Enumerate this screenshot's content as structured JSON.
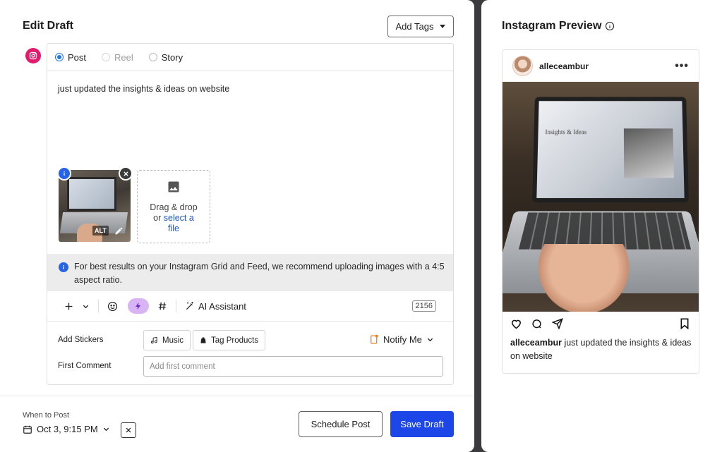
{
  "editor": {
    "title": "Edit Draft",
    "add_tags_label": "Add Tags",
    "post_types": [
      {
        "label": "Post",
        "selected": true,
        "disabled": false
      },
      {
        "label": "Reel",
        "selected": false,
        "disabled": true
      },
      {
        "label": "Story",
        "selected": false,
        "disabled": false
      }
    ],
    "caption": "just updated the insights & ideas on website",
    "media": {
      "alt_label": "ALT"
    },
    "dropzone": {
      "line1": "Drag & drop",
      "line2_prefix": "or ",
      "link_text": "select a",
      "line3": "file"
    },
    "notice": "For best results on your Instagram Grid and Feed, we recommend uploading images with a 4:5 aspect ratio.",
    "toolbar": {
      "ai_label": "AI Assistant",
      "char_count": "2156"
    },
    "stickers": {
      "label": "Add Stickers",
      "music_label": "Music",
      "tag_products_label": "Tag Products",
      "notify_label": "Notify Me"
    },
    "first_comment": {
      "label": "First Comment",
      "placeholder": "Add first comment",
      "value": ""
    }
  },
  "footer": {
    "when_label": "When to Post",
    "date_value": "Oct 3, 9:15 PM",
    "schedule_label": "Schedule Post",
    "save_label": "Save Draft"
  },
  "preview": {
    "title": "Instagram Preview",
    "username": "alleceambur",
    "more": "•••",
    "photo_text": "Insights & Ideas",
    "caption_user": "alleceambur",
    "caption_text": "just updated the insights & ideas on website"
  },
  "colors": {
    "primary": "#1d46e8",
    "instagram": "#e31b6d",
    "bolt_bg": "#d9b4f5",
    "info_blue": "#2563eb",
    "notify_orange": "#f07c1e"
  }
}
